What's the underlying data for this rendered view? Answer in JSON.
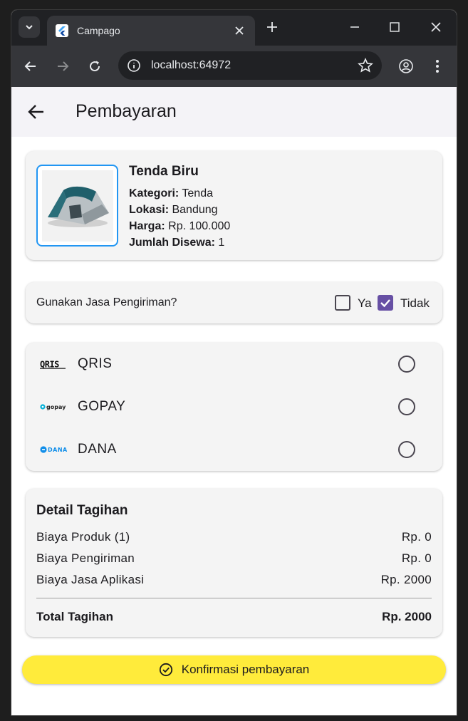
{
  "browser": {
    "tab_title": "Campago",
    "url": "localhost:64972"
  },
  "app": {
    "page_title": "Pembayaran",
    "product": {
      "name": "Tenda Biru",
      "category_label": "Kategori:",
      "category": "Tenda",
      "location_label": "Lokasi:",
      "location": "Bandung",
      "price_label": "Harga:",
      "price": "Rp. 100.000",
      "qty_label": "Jumlah Disewa:",
      "qty": "1"
    },
    "shipping": {
      "question": "Gunakan Jasa Pengiriman?",
      "yes_label": "Ya",
      "yes_checked": false,
      "no_label": "Tidak",
      "no_checked": true
    },
    "payment_methods": [
      {
        "name": "QRIS",
        "logo": "QRIS",
        "selected": false
      },
      {
        "name": "GOPAY",
        "logo": "gopay",
        "selected": false
      },
      {
        "name": "DANA",
        "logo": "DANA",
        "selected": false
      }
    ],
    "bill": {
      "title": "Detail Tagihan",
      "rows": [
        {
          "label": "Biaya Produk (1)",
          "value": "Rp. 0"
        },
        {
          "label": "Biaya Pengiriman",
          "value": "Rp. 0"
        },
        {
          "label": "Biaya Jasa Aplikasi",
          "value": "Rp. 2000"
        }
      ],
      "total_label": "Total Tagihan",
      "total_value": "Rp. 2000"
    },
    "confirm_label": "Konfirmasi pembayaran"
  },
  "colors": {
    "accent_checkbox": "#6750a4",
    "product_border": "#2196f3",
    "confirm_button": "#ffeb3b",
    "card_bg": "#f4f4f4"
  }
}
